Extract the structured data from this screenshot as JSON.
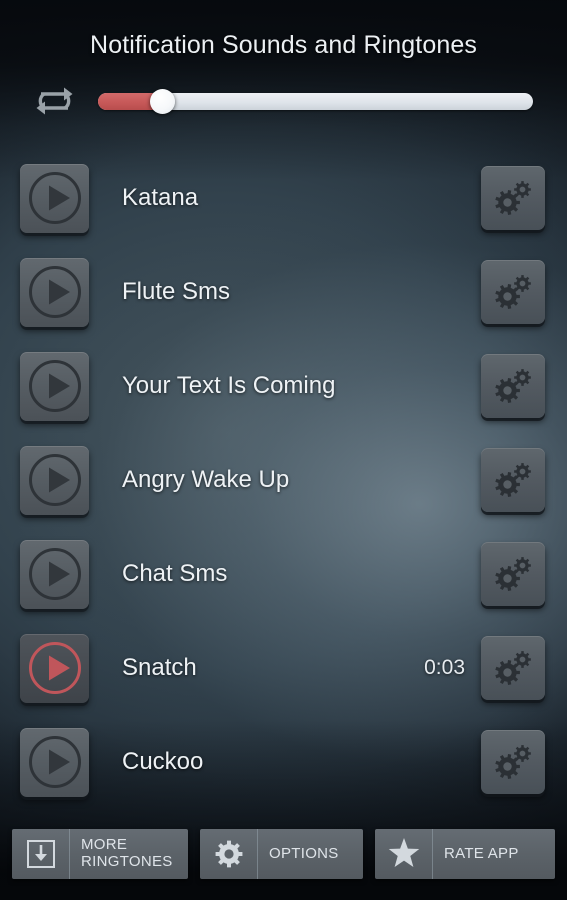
{
  "header": {
    "title": "Notification Sounds and Ringtones",
    "loop_icon": "repeat-loop-icon",
    "loop_enabled": true
  },
  "volume_slider": {
    "name": "volume-slider",
    "value": 12,
    "min": 0,
    "max": 100,
    "fill_color": "#c75959",
    "track_color": "#e4e9ee",
    "thumb_color": "#ffffff"
  },
  "list": {
    "play_icon": "play-icon",
    "settings_icon": "gears-icon",
    "items": [
      {
        "label": "Katana",
        "time": "",
        "playing": false
      },
      {
        "label": "Flute Sms",
        "time": "",
        "playing": false
      },
      {
        "label": "Your Text Is Coming",
        "time": "",
        "playing": false
      },
      {
        "label": "Angry Wake Up",
        "time": "",
        "playing": false
      },
      {
        "label": "Chat Sms",
        "time": "",
        "playing": false
      },
      {
        "label": "Snatch",
        "time": "0:03",
        "playing": true
      },
      {
        "label": "Cuckoo",
        "time": "",
        "playing": false
      }
    ]
  },
  "bottom_bar": {
    "buttons": [
      {
        "label": "MORE\nRINGTONES",
        "icon": "download-icon"
      },
      {
        "label": "OPTIONS",
        "icon": "gear-icon"
      },
      {
        "label": "RATE APP",
        "icon": "star-icon"
      }
    ]
  },
  "colors": {
    "accent_red": "#c75959",
    "playing_red": "#c0565b",
    "button_face": "#565d63",
    "text_primary": "#eef2f5",
    "background_dark": "#0d1117"
  }
}
